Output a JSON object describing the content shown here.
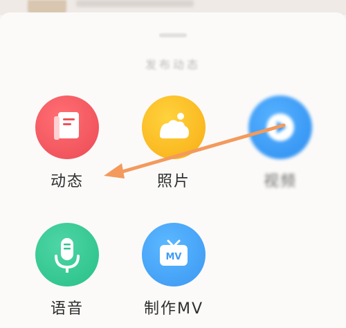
{
  "sheet": {
    "title": "发布动态"
  },
  "options": [
    {
      "label": "动态",
      "icon": "document-icon",
      "color": "#ee5058"
    },
    {
      "label": "照片",
      "icon": "photo-icon",
      "color": "#f9b51c"
    },
    {
      "label": "视频",
      "icon": "video-icon",
      "color": "#3296f4"
    },
    {
      "label": "语音",
      "icon": "microphone-icon",
      "color": "#2fc48d"
    },
    {
      "label": "制作MV",
      "icon": "mv-tv-icon",
      "color": "#419cf4"
    }
  ],
  "mv_badge": "MV",
  "annotation": {
    "color": "#f39a5c"
  }
}
